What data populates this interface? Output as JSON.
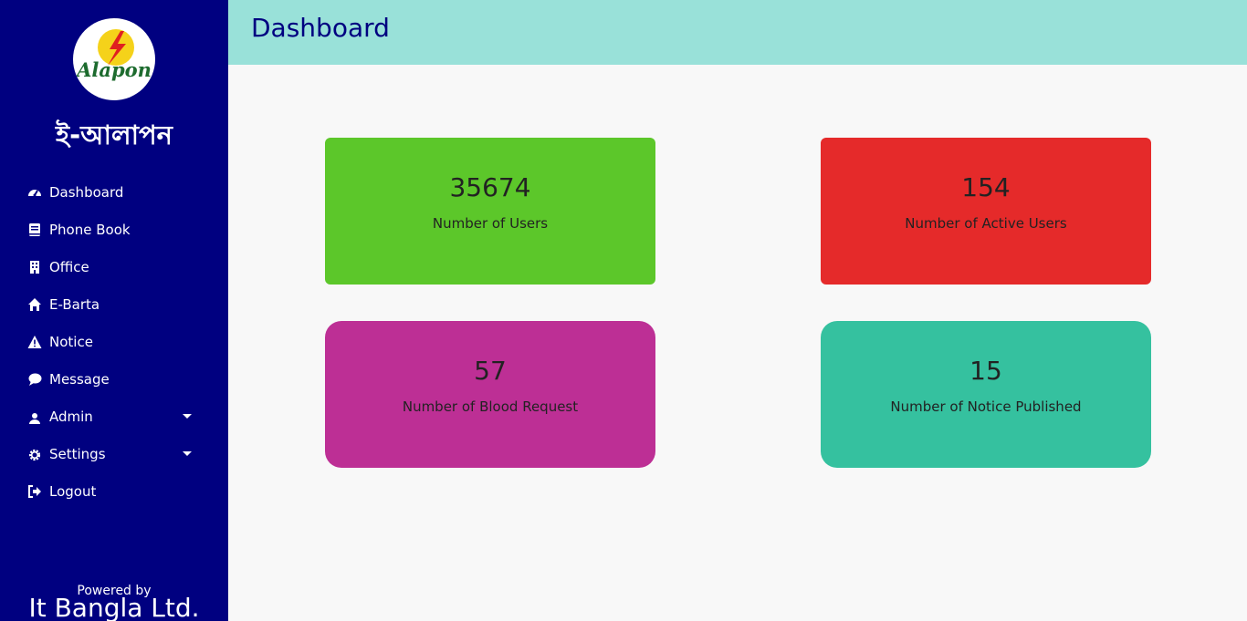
{
  "sidebar": {
    "logo_text": "Alapon",
    "brand": "ই-আলাপন",
    "items": [
      {
        "label": "Dashboard",
        "icon": "dashboard-gauge-icon"
      },
      {
        "label": "Phone Book",
        "icon": "phone-book-icon"
      },
      {
        "label": "Office",
        "icon": "office-building-icon"
      },
      {
        "label": "E-Barta",
        "icon": "home-icon"
      },
      {
        "label": "Notice",
        "icon": "warning-triangle-icon"
      },
      {
        "label": "Message",
        "icon": "chat-bubble-icon"
      },
      {
        "label": "Admin",
        "icon": "user-icon",
        "has_dropdown": true
      },
      {
        "label": "Settings",
        "icon": "gear-icon",
        "has_dropdown": true
      },
      {
        "label": "Logout",
        "icon": "logout-icon"
      }
    ],
    "powered_by": "Powered by",
    "company": "It Bangla Ltd."
  },
  "header": {
    "title": "Dashboard"
  },
  "cards": [
    {
      "value": "35674",
      "label": "Number of Users",
      "color": "#5cc72a"
    },
    {
      "value": "154",
      "label": "Number of Active Users",
      "color": "#e52a2a"
    },
    {
      "value": "57",
      "label": "Number of Blood Request",
      "color": "#bd2f95"
    },
    {
      "value": "15",
      "label": "Number of Notice Published",
      "color": "#35c19f"
    }
  ],
  "colors": {
    "sidebar_bg": "#000080",
    "topbar_bg": "#99e1d9",
    "title_color": "#000080",
    "content_bg": "#f8f8f8"
  }
}
